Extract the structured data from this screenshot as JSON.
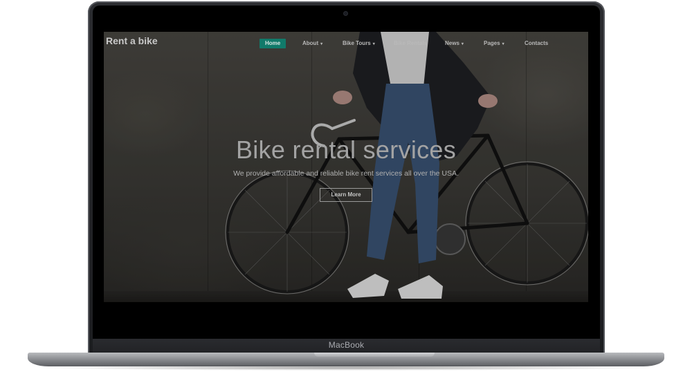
{
  "site": {
    "logo": "Rent a bike"
  },
  "nav": {
    "items": [
      {
        "label": "Home",
        "dropdown": false,
        "active": true
      },
      {
        "label": "About",
        "dropdown": true,
        "active": false
      },
      {
        "label": "Bike Tours",
        "dropdown": true,
        "active": false
      },
      {
        "label": "Bike Rentals",
        "dropdown": false,
        "active": false
      },
      {
        "label": "News",
        "dropdown": true,
        "active": false
      },
      {
        "label": "Pages",
        "dropdown": true,
        "active": false
      },
      {
        "label": "Contacts",
        "dropdown": false,
        "active": false
      }
    ],
    "caret_glyph": "▾",
    "active_color": "#117a6a"
  },
  "hero": {
    "title": "Bike rental services",
    "subtitle": "We provide affordable and reliable bike rent services all over the USA.",
    "button_label": "Learn More"
  },
  "device": {
    "brand": "MacBook"
  }
}
